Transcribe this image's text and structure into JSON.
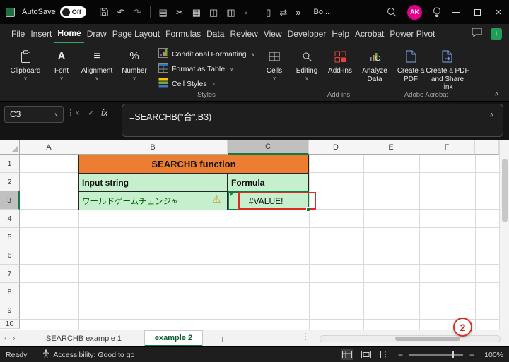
{
  "titlebar": {
    "autosave_label": "AutoSave",
    "autosave_state": "Off",
    "doc_title": "Bo...",
    "avatar_initials": "AK"
  },
  "menubar": {
    "items": [
      "File",
      "Insert",
      "Home",
      "Draw",
      "Page Layout",
      "Formulas",
      "Data",
      "Review",
      "View",
      "Developer",
      "Help",
      "Acrobat",
      "Power Pivot"
    ],
    "active_item": "Home"
  },
  "ribbon": {
    "buttons": {
      "clipboard": "Clipboard",
      "font": "Font",
      "alignment": "Alignment",
      "number": "Number",
      "conditional_formatting": "Conditional Formatting",
      "format_as_table": "Format as Table",
      "cell_styles": "Cell Styles",
      "cells": "Cells",
      "editing": "Editing",
      "addins": "Add-ins",
      "analyze_data": "Analyze Data",
      "create_pdf": "Create a PDF",
      "create_pdf_share": "Create a PDF and Share link"
    },
    "group_labels": {
      "styles": "Styles",
      "addins": "Add-ins",
      "acrobat": "Adobe Acrobat"
    }
  },
  "formula_bar": {
    "name_box": "C3",
    "fx_label": "fx",
    "formula": "=SEARCHB(\"合\",B3)"
  },
  "grid": {
    "column_headers": [
      "A",
      "B",
      "C",
      "D",
      "E",
      "F"
    ],
    "row_headers": [
      "1",
      "2",
      "3",
      "4",
      "5",
      "6",
      "7",
      "8",
      "9",
      "10"
    ],
    "selected_cell": "C3",
    "cells": {
      "title": "SEARCHB function",
      "input_header": "Input string",
      "formula_header": "Formula",
      "input_value": "ワールドゲームチェンジャ",
      "error_value": "#VALUE!"
    }
  },
  "sheet_tabs": {
    "tabs": [
      "SEARCHB example 1",
      "example 2"
    ],
    "active_tab": "example 2",
    "add_label": "+"
  },
  "annotations": {
    "step_badge": "2"
  },
  "statusbar": {
    "mode": "Ready",
    "accessibility": "Accessibility: Good to go",
    "zoom_level": "100%"
  },
  "colors": {
    "accent_green": "#107C41",
    "table_header_orange": "#ED7D31",
    "cell_fill_green": "#C6EFCE",
    "annotation_red": "#E02B20",
    "avatar_pink": "#E3008C"
  }
}
